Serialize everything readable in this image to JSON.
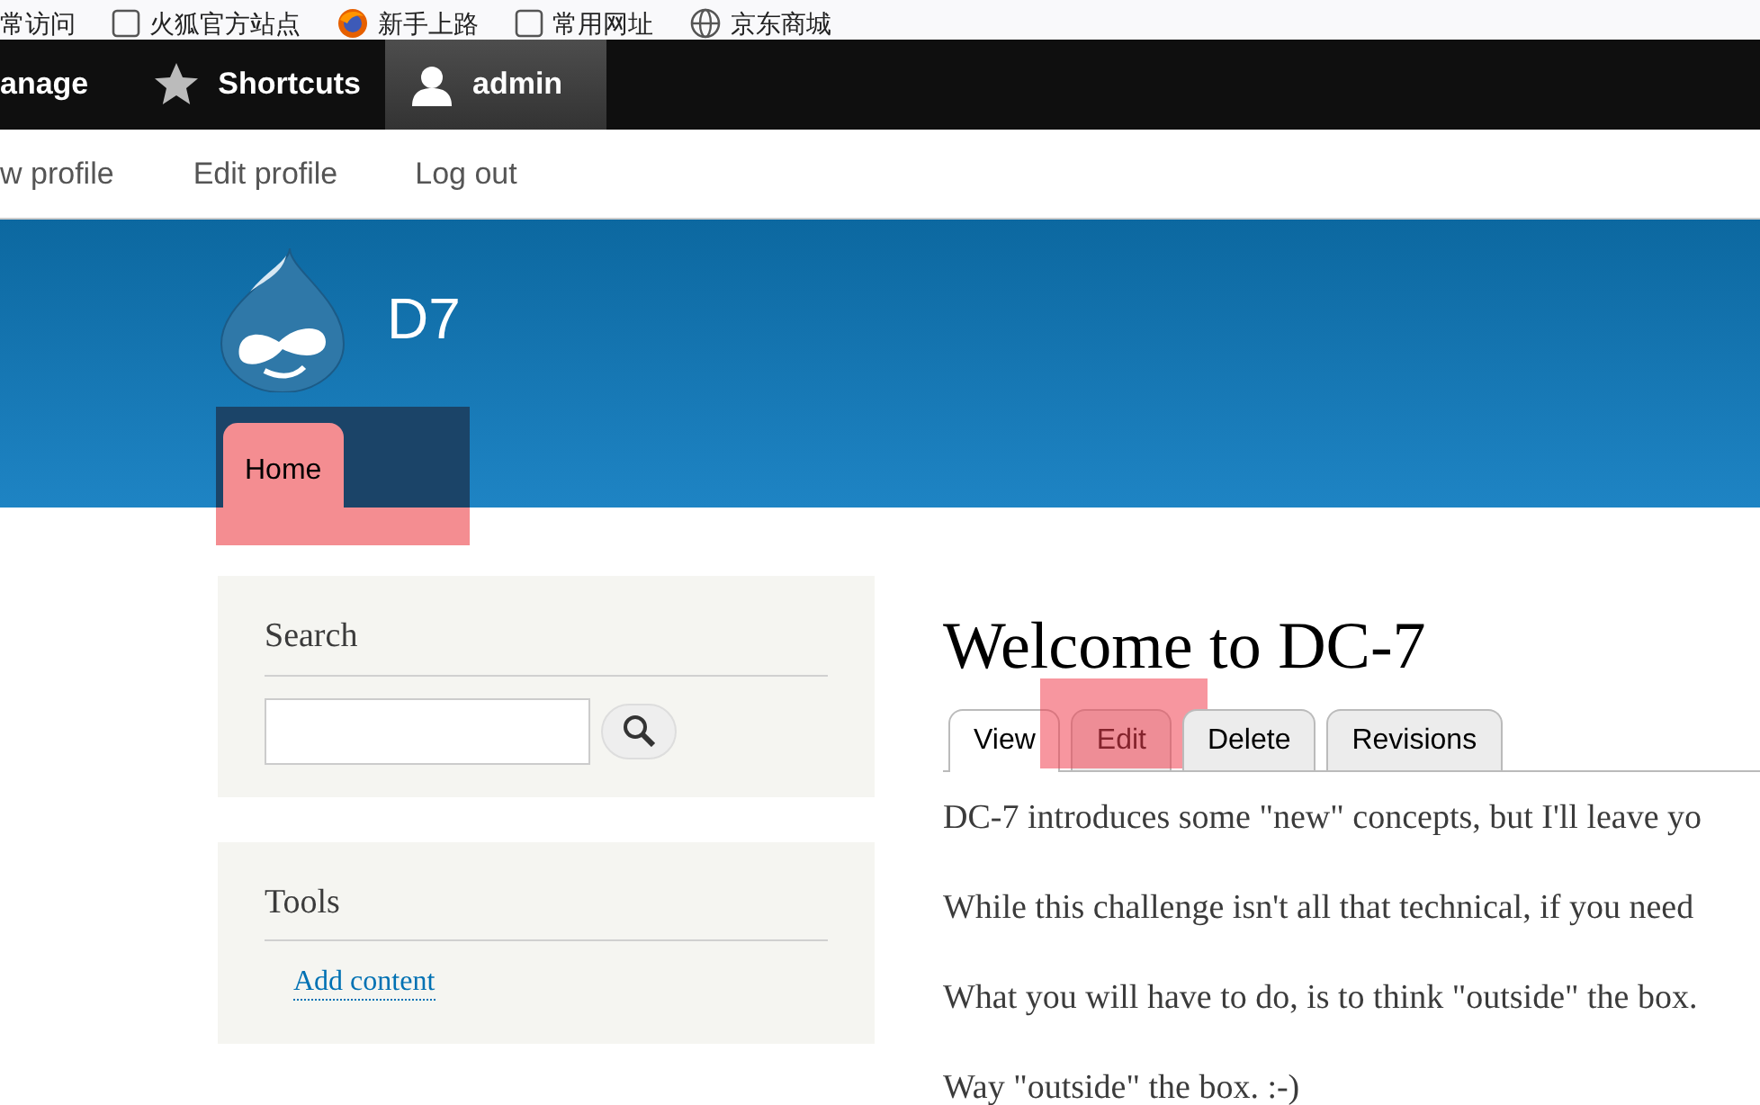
{
  "bookmarks": [
    {
      "label": "常访问",
      "kind": "none"
    },
    {
      "label": "火狐官方站点",
      "kind": "page"
    },
    {
      "label": "新手上路",
      "kind": "firefox"
    },
    {
      "label": "常用网址",
      "kind": "page"
    },
    {
      "label": "京东商城",
      "kind": "globe"
    }
  ],
  "toolbar": [
    {
      "label": "anage",
      "kind": "none",
      "selected": false
    },
    {
      "label": "Shortcuts",
      "kind": "star",
      "selected": false
    },
    {
      "label": "admin",
      "kind": "user",
      "selected": true
    }
  ],
  "tray": [
    "w profile",
    "Edit profile",
    "Log out"
  ],
  "site_name": "D7",
  "main_menu": [
    {
      "label": "Home",
      "highlighted": true
    }
  ],
  "sidebar": [
    {
      "title": "Search",
      "kind": "search"
    },
    {
      "title": "Tools",
      "kind": "links",
      "links": [
        "Add content"
      ]
    }
  ],
  "page_title": "Welcome to DC-7",
  "tabs": [
    {
      "label": "View",
      "selected": true,
      "highlighted": false
    },
    {
      "label": "Edit",
      "selected": false,
      "highlighted": true
    },
    {
      "label": "Delete",
      "selected": false,
      "highlighted": false
    },
    {
      "label": "Revisions",
      "selected": false,
      "highlighted": false
    }
  ],
  "paragraphs": [
    "DC-7 introduces some \"new\" concepts, but I'll leave yo",
    "While this challenge isn't all that technical, if you need",
    "What you will have to do, is to think \"outside\" the box.",
    "Way \"outside\" the box.  :-)"
  ]
}
